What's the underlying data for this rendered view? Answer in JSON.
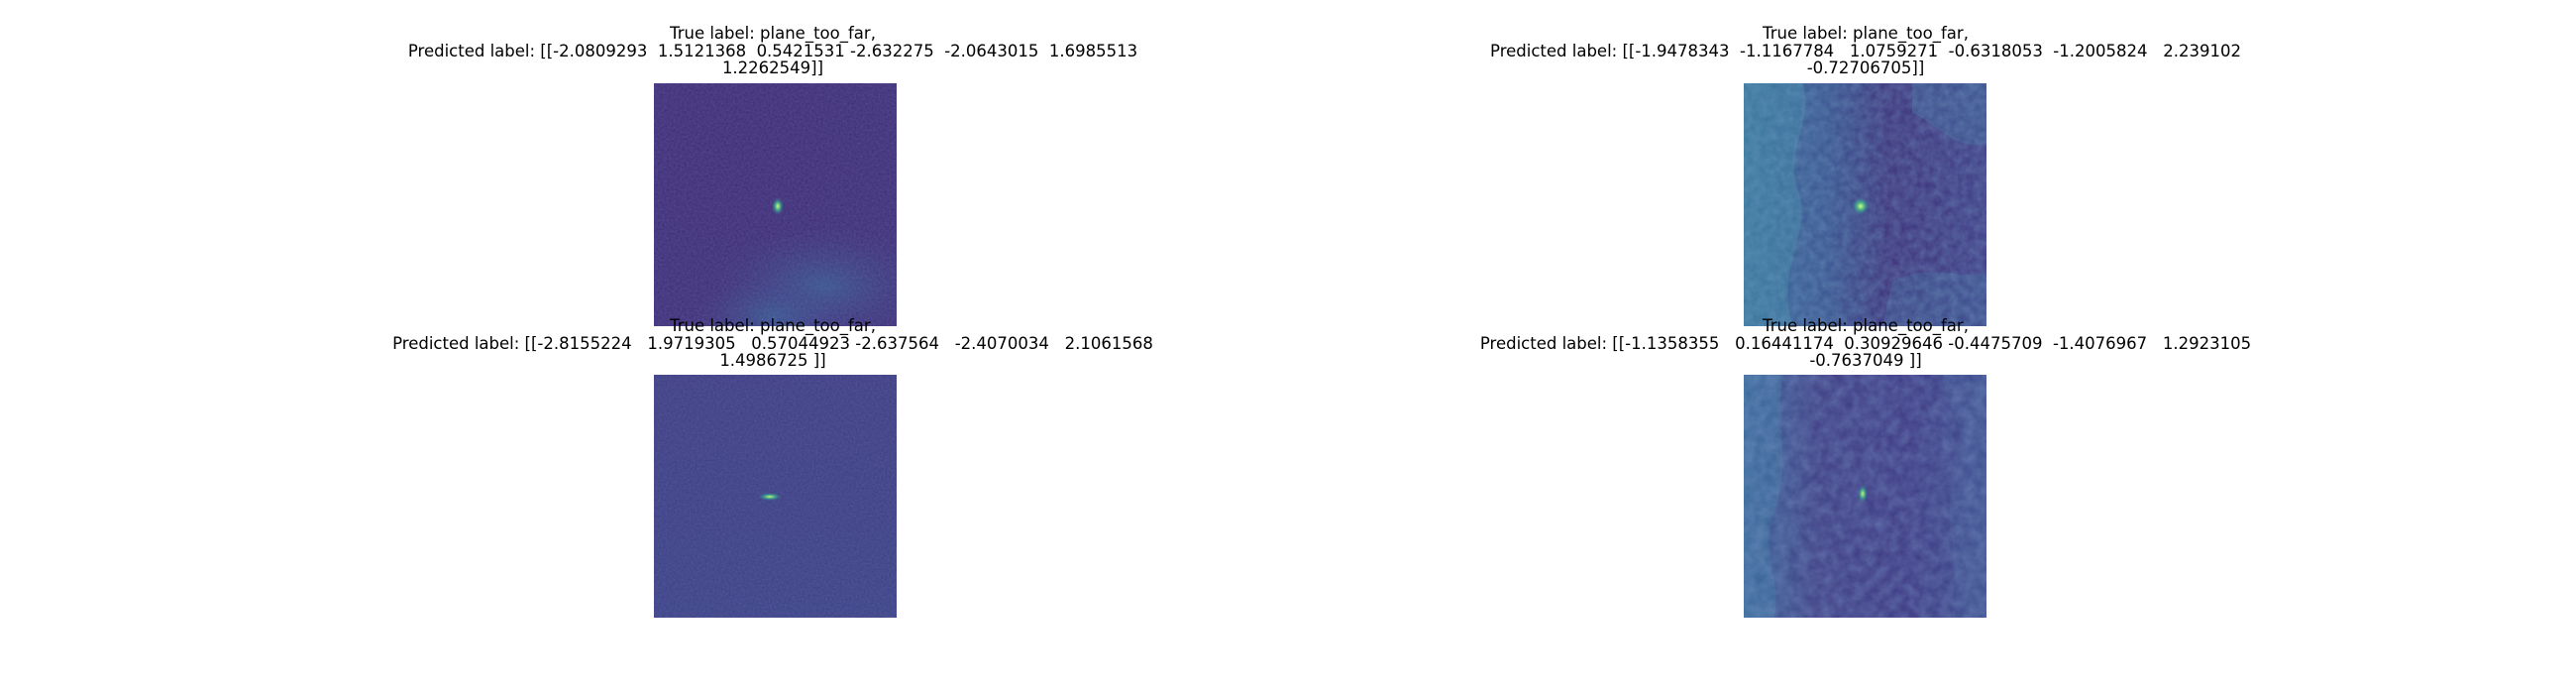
{
  "figure": {
    "panels": [
      {
        "true_label_line": "True label: plane_too_far,",
        "predicted_line_1": "Predicted label: [[-2.0809293  1.5121368  0.5421531 -2.632275  -2.0643015  1.6985513",
        "predicted_line_2": "1.2262549]]",
        "colormap": "viridis"
      },
      {
        "true_label_line": "True label: plane_too_far,",
        "predicted_line_1": "Predicted label: [[-1.9478343  -1.1167784   1.0759271  -0.6318053  -1.2005824   2.239102",
        "predicted_line_2": "-0.72706705]]",
        "colormap": "viridis"
      },
      {
        "true_label_line": "True label: plane_too_far,",
        "predicted_line_1": "Predicted label: [[-2.8155224   1.9719305   0.57044923 -2.637564   -2.4070034   2.1061568",
        "predicted_line_2": "1.4986725 ]]",
        "colormap": "viridis"
      },
      {
        "true_label_line": "True label: plane_too_far,",
        "predicted_line_1": "Predicted label: [[-1.1358355   0.16441174  0.30929646 -0.4475709  -1.4076967   1.2923105",
        "predicted_line_2": "-0.7637049 ]]",
        "colormap": "viridis"
      }
    ]
  },
  "colors": {
    "background": "#ffffff",
    "viridis_dark": "#3b1f6b",
    "viridis_mid": "#3a5a9a",
    "viridis_teal": "#2a8a8a",
    "viridis_bright": "#c8e85a"
  }
}
